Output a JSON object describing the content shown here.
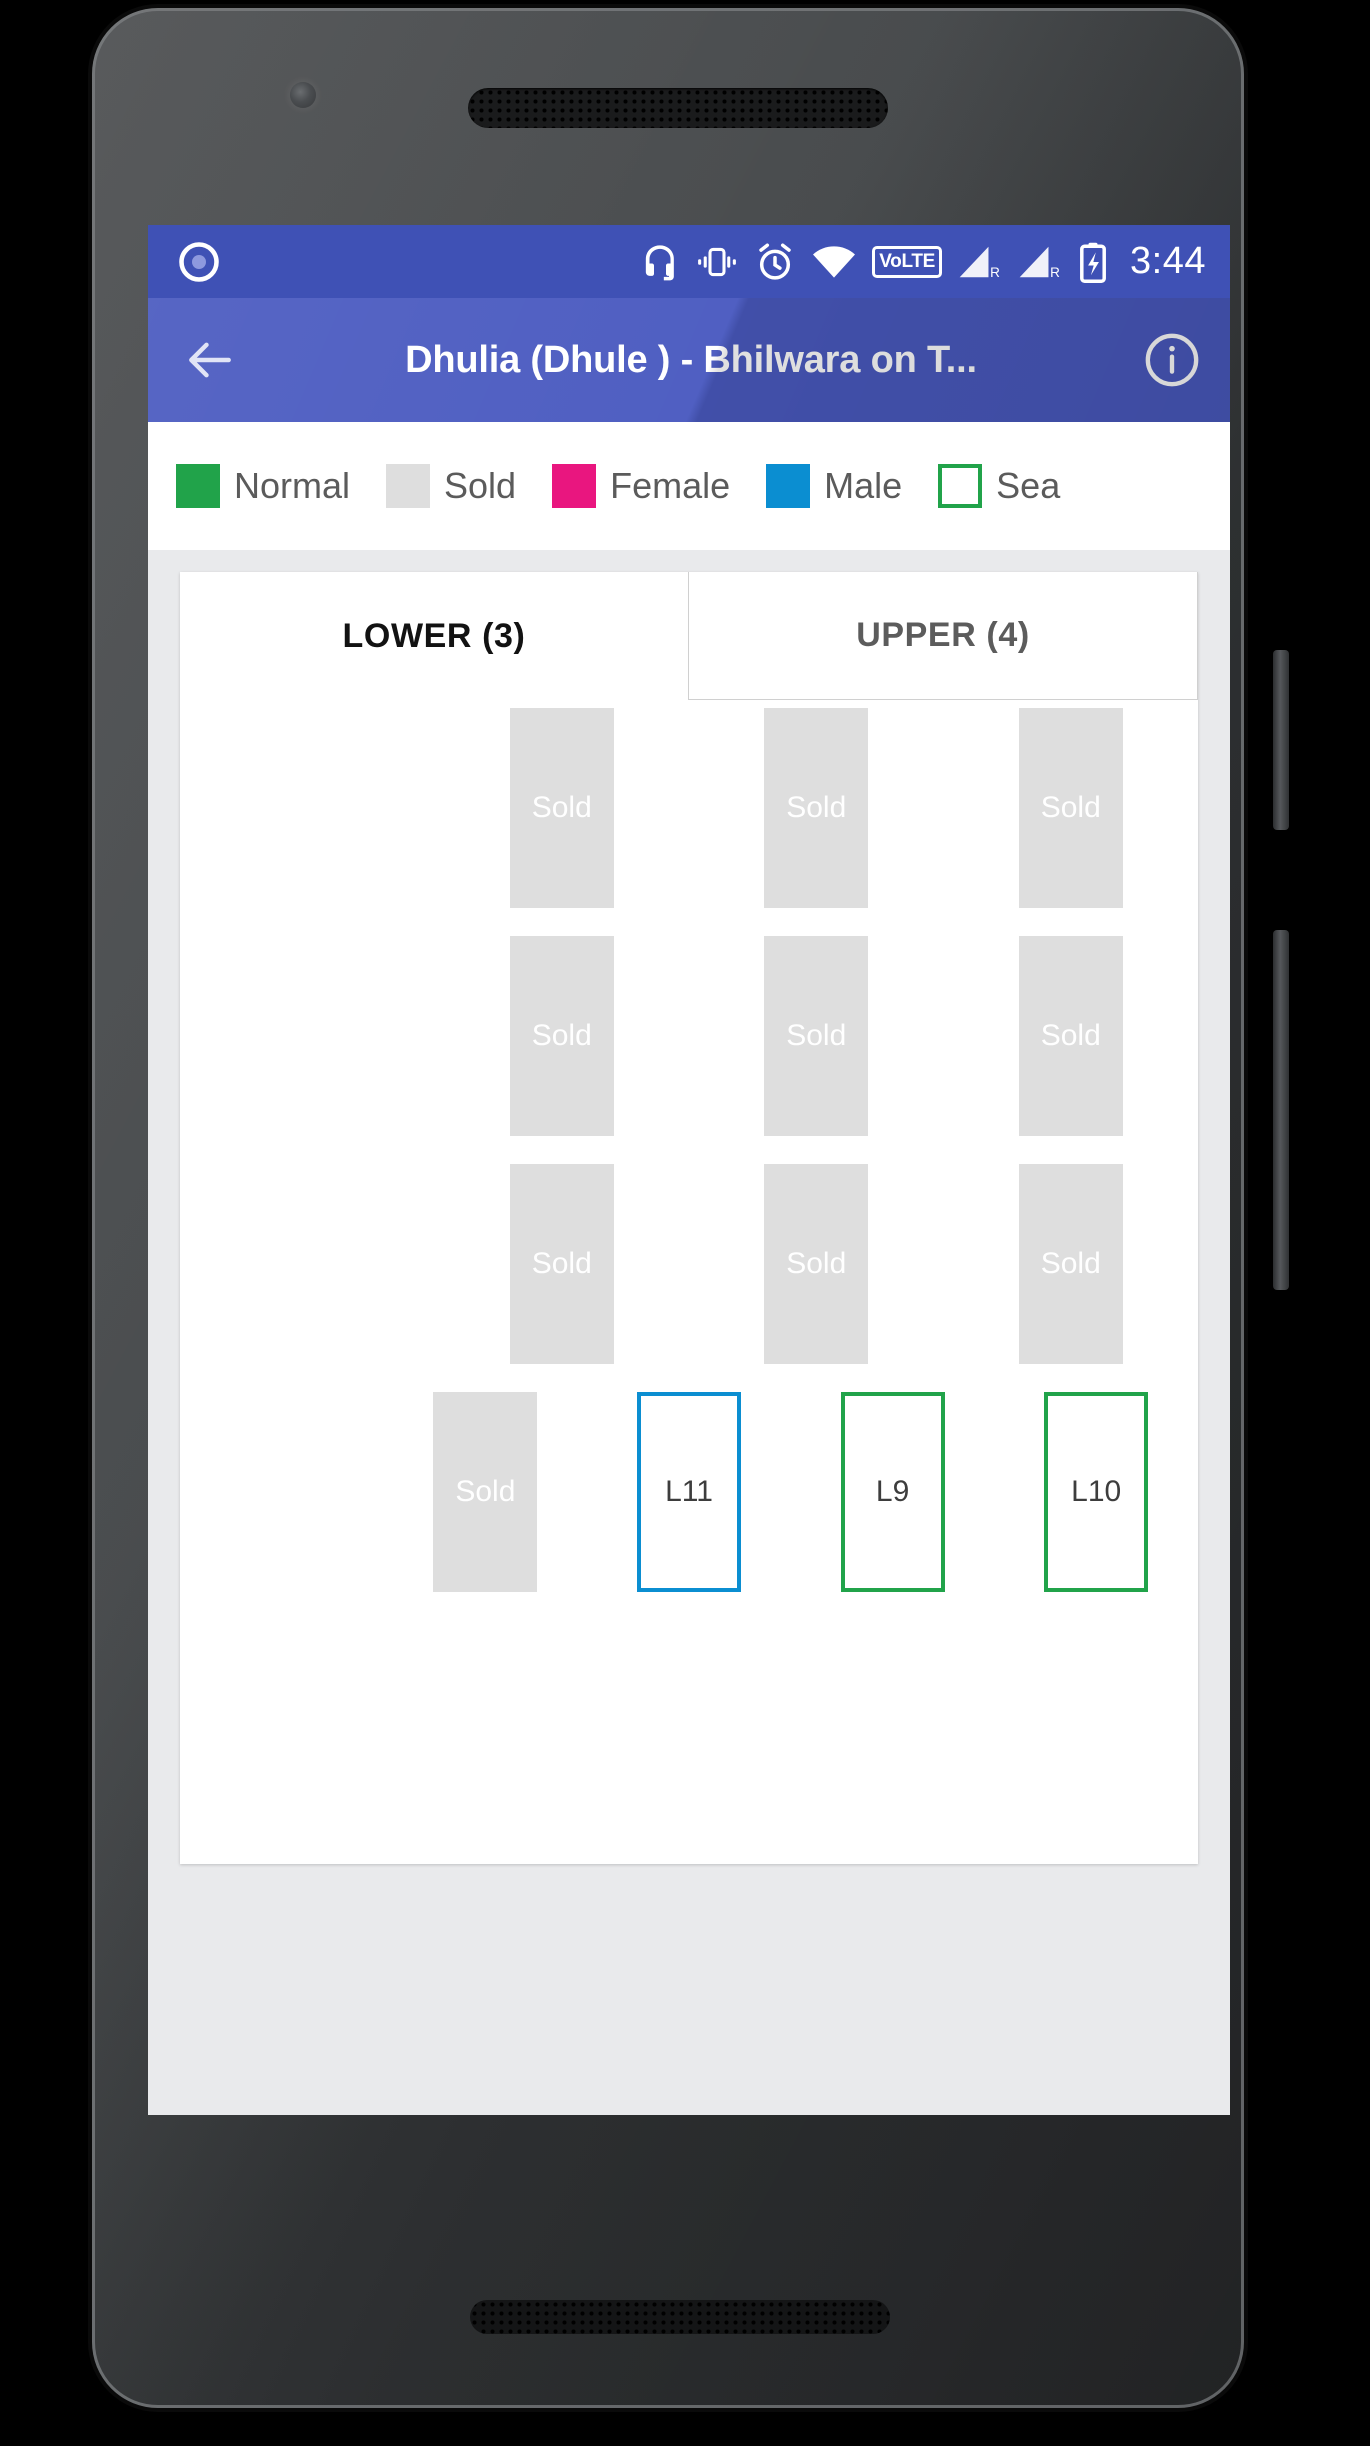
{
  "status_bar": {
    "time": "3:44",
    "volte_label": "VoLTE",
    "icons": [
      {
        "name": "app-notification-icon"
      },
      {
        "name": "headset-icon"
      },
      {
        "name": "vibrate-icon"
      },
      {
        "name": "alarm-icon"
      },
      {
        "name": "wifi-icon"
      },
      {
        "name": "volte-icon"
      },
      {
        "name": "signal-r1-icon"
      },
      {
        "name": "signal-r2-icon"
      },
      {
        "name": "battery-charging-icon"
      }
    ],
    "sim_badge_1": "R",
    "sim_badge_2": "R",
    "background": "#3f51b5"
  },
  "app_bar": {
    "back_label": "Back",
    "title": "Dhulia (Dhule ) - Bhilwara on T...",
    "info_label": "Info",
    "background": "#4a5ac0"
  },
  "legend": {
    "items": [
      {
        "label": "Normal",
        "color": "#21a34a",
        "style": "filled"
      },
      {
        "label": "Sold",
        "color": "#dedede",
        "style": "filled"
      },
      {
        "label": "Female",
        "color": "#e9167f",
        "style": "filled"
      },
      {
        "label": "Male",
        "color": "#0b8ed1",
        "style": "filled"
      },
      {
        "label": "Sea",
        "color": "#21a34a",
        "style": "outline"
      }
    ]
  },
  "tabs": [
    {
      "label": "LOWER (3)",
      "active": true
    },
    {
      "label": "UPPER (4)",
      "active": false
    }
  ],
  "seat_layout": {
    "rows": [
      [
        {
          "state": "empty",
          "label": ""
        },
        {
          "state": "sold",
          "label": "Sold"
        },
        {
          "state": "sold",
          "label": "Sold"
        },
        {
          "state": "sold",
          "label": "Sold"
        }
      ],
      [
        {
          "state": "empty",
          "label": ""
        },
        {
          "state": "sold",
          "label": "Sold"
        },
        {
          "state": "sold",
          "label": "Sold"
        },
        {
          "state": "sold",
          "label": "Sold"
        }
      ],
      [
        {
          "state": "empty",
          "label": ""
        },
        {
          "state": "sold",
          "label": "Sold"
        },
        {
          "state": "sold",
          "label": "Sold"
        },
        {
          "state": "sold",
          "label": "Sold"
        }
      ],
      [
        {
          "state": "empty",
          "label": ""
        },
        {
          "state": "sold",
          "label": "Sold"
        },
        {
          "state": "male",
          "label": "L11"
        },
        {
          "state": "normal",
          "label": "L9"
        },
        {
          "state": "normal",
          "label": "L10"
        }
      ]
    ]
  },
  "colors": {
    "primary": "#3f51b5",
    "app_bar": "#4a5ac0",
    "page_bg": "#e9eaec",
    "sold": "#dedede",
    "normal": "#21a34a",
    "female": "#e9167f",
    "male": "#0b8ed1"
  }
}
